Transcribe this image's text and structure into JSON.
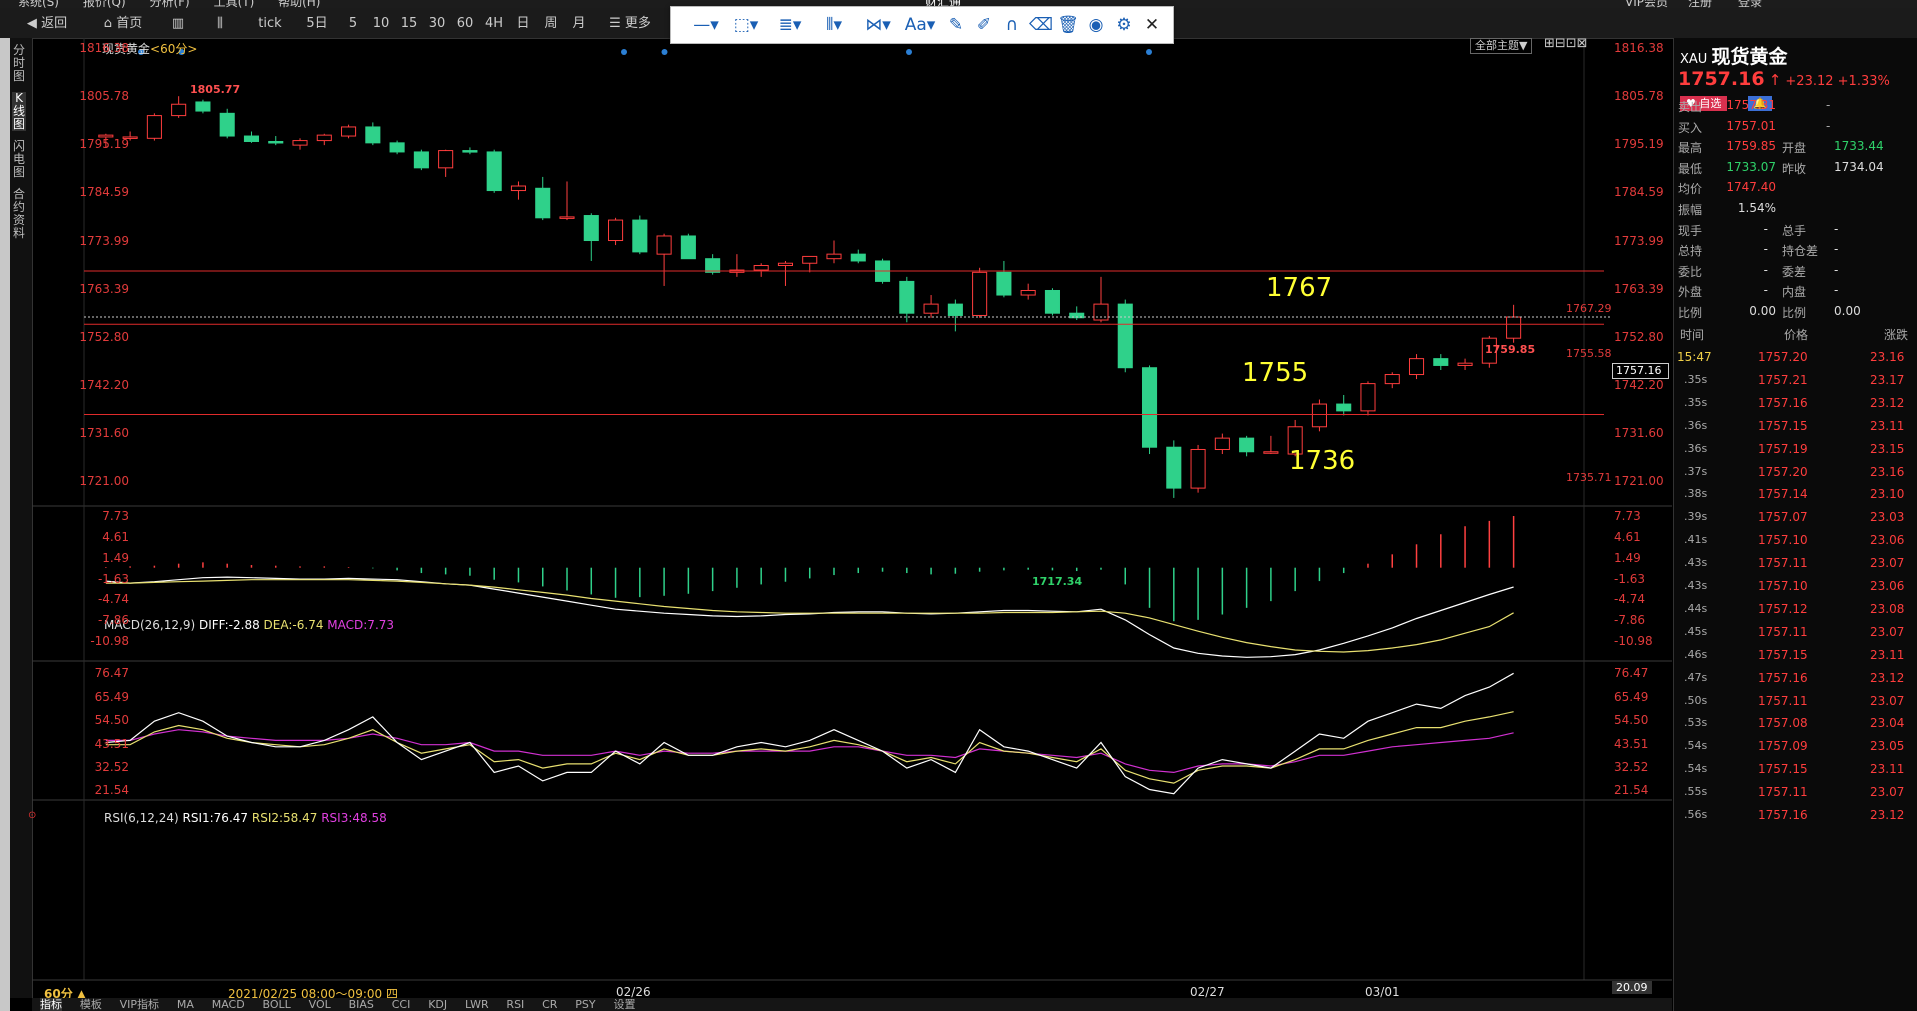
{
  "menubar": [
    "系统(S)",
    "报价(Q)",
    "分析(F)",
    "工具(T)",
    "帮助(H)"
  ],
  "app_title": "财汇通",
  "top_right": [
    "VIP会员",
    "注册",
    "登录"
  ],
  "toolbar": {
    "back": "返回",
    "home": "首页",
    "tick": "tick",
    "periods": [
      "5日",
      "5",
      "10",
      "15",
      "30",
      "60",
      "4H",
      "日",
      "周",
      "月"
    ],
    "more": "更多"
  },
  "draw_tools": {
    "items": [
      "line-tool",
      "shape-tool",
      "fib-tool",
      "channel-tool",
      "pattern-tool",
      "text-tool",
      "brush-tool",
      "marker-tool",
      "magnet-tool",
      "eraser-tool",
      "delete-tool",
      "eye-tool",
      "gear-tool",
      "close-tool"
    ],
    "text_label": "Aa"
  },
  "side_tabs": [
    "分时图",
    "K线图",
    "闪电图",
    "合约资料"
  ],
  "chart_header": {
    "name": "现货黄金",
    "period": "<60分>",
    "theme": "全部主题▼"
  },
  "price_axis": [
    "1816.38",
    "1805.78",
    "1795.19",
    "1784.59",
    "1773.99",
    "1763.39",
    "1752.80",
    "1742.20",
    "1731.60",
    "1721.00"
  ],
  "annotations": {
    "high": "1805.77",
    "low": "1717.34",
    "hi2": "1759.85",
    "l1767": "1767",
    "l1755": "1755",
    "l1736": "1736",
    "r1767": "1767.29",
    "r1755": "1755.58",
    "r1736": "1735.71",
    "last": "1757.16"
  },
  "macd": {
    "header": "MACD(26,12,9)",
    "diff": "DIFF:-2.88",
    "dea": "DEA:-6.74",
    "macd": "MACD:7.73",
    "axis": [
      "7.73",
      "4.61",
      "1.49",
      "-1.63",
      "-4.74",
      "-7.86",
      "-10.98"
    ]
  },
  "rsi": {
    "header": "RSI(6,12,24)",
    "rsi1": "RSI1:76.47",
    "rsi2": "RSI2:58.47",
    "rsi3": "RSI3:48.58",
    "axis": [
      "76.47",
      "65.49",
      "54.50",
      "43.51",
      "32.52",
      "21.54"
    ],
    "last": "20.09"
  },
  "xaxis": {
    "period_btn": "60分 ▲",
    "range": "2021/02/25 08:00～09:00 四",
    "dates": [
      "02/26",
      "02/27",
      "03/01"
    ]
  },
  "bottom_tabs": [
    "指标",
    "模板",
    "VIP指标",
    "MA",
    "MACD",
    "BOLL",
    "VOL",
    "BIAS",
    "CCI",
    "KDJ",
    "LWR",
    "RSI",
    "CR",
    "PSY",
    "设置"
  ],
  "chart_data": {
    "type": "candlestick",
    "title": "现货黄金 60分",
    "ohlc": [
      [
        1796.8,
        1797.5,
        1794.5,
        1797.2
      ],
      [
        1796.8,
        1798.0,
        1796.0,
        1796.8
      ],
      [
        1796.5,
        1802.0,
        1796.0,
        1801.5
      ],
      [
        1801.5,
        1805.77,
        1801.0,
        1804.0
      ],
      [
        1804.5,
        1805.0,
        1802.0,
        1802.5
      ],
      [
        1802.0,
        1803.0,
        1796.5,
        1797.0
      ],
      [
        1797.0,
        1798.0,
        1795.5,
        1795.8
      ],
      [
        1795.8,
        1797.0,
        1795.0,
        1795.6
      ],
      [
        1795.0,
        1796.5,
        1794.0,
        1796.0
      ],
      [
        1796.0,
        1797.5,
        1795.0,
        1797.2
      ],
      [
        1797.0,
        1799.5,
        1796.5,
        1799.0
      ],
      [
        1799.0,
        1800.0,
        1795.0,
        1795.5
      ],
      [
        1795.5,
        1796.0,
        1793.0,
        1793.5
      ],
      [
        1793.5,
        1794.0,
        1789.5,
        1790.0
      ],
      [
        1790.0,
        1794.0,
        1788.0,
        1793.8
      ],
      [
        1793.8,
        1794.5,
        1793.0,
        1793.5
      ],
      [
        1793.5,
        1794.0,
        1784.5,
        1785.0
      ],
      [
        1785.0,
        1787.0,
        1783.0,
        1786.0
      ],
      [
        1785.5,
        1788.0,
        1778.5,
        1779.0
      ],
      [
        1779.0,
        1787.0,
        1778.5,
        1779.2
      ],
      [
        1779.5,
        1780.0,
        1769.5,
        1774.0
      ],
      [
        1774.0,
        1779.0,
        1773.0,
        1778.5
      ],
      [
        1778.5,
        1779.5,
        1771.0,
        1771.5
      ],
      [
        1771.0,
        1775.5,
        1764.0,
        1775.0
      ],
      [
        1775.0,
        1775.5,
        1770.0,
        1770.0
      ],
      [
        1770.0,
        1771.0,
        1766.5,
        1767.0
      ],
      [
        1767.0,
        1771.0,
        1766.0,
        1767.5
      ],
      [
        1767.5,
        1769.0,
        1766.0,
        1768.5
      ],
      [
        1768.5,
        1769.5,
        1764.0,
        1769.0
      ],
      [
        1769.0,
        1770.5,
        1767.0,
        1770.5
      ],
      [
        1770.0,
        1774.0,
        1769.0,
        1771.0
      ],
      [
        1771.0,
        1772.0,
        1769.0,
        1769.5
      ],
      [
        1769.5,
        1770.0,
        1764.5,
        1765.0
      ],
      [
        1765.0,
        1766.0,
        1756.0,
        1758.0
      ],
      [
        1758.0,
        1762.0,
        1757.0,
        1760.0
      ],
      [
        1760.0,
        1761.0,
        1754.0,
        1757.5
      ],
      [
        1757.5,
        1768.0,
        1757.0,
        1767.0
      ],
      [
        1767.0,
        1769.5,
        1761.5,
        1762.0
      ],
      [
        1762.0,
        1764.5,
        1761.0,
        1763.0
      ],
      [
        1763.0,
        1763.5,
        1757.5,
        1758.0
      ],
      [
        1758.0,
        1759.5,
        1756.5,
        1757.0
      ],
      [
        1756.5,
        1766.0,
        1756.0,
        1760.0
      ],
      [
        1760.0,
        1761.0,
        1745.0,
        1746.0
      ],
      [
        1746.0,
        1746.5,
        1727.0,
        1728.5
      ],
      [
        1728.5,
        1730.0,
        1717.34,
        1719.5
      ],
      [
        1719.5,
        1729.0,
        1718.5,
        1728.0
      ],
      [
        1728.0,
        1731.5,
        1727.0,
        1730.5
      ],
      [
        1730.5,
        1731.0,
        1726.5,
        1727.5
      ],
      [
        1727.5,
        1731.0,
        1727.0,
        1727.5
      ],
      [
        1727.0,
        1734.5,
        1726.5,
        1733.0
      ],
      [
        1733.0,
        1739.0,
        1732.0,
        1738.0
      ],
      [
        1738.0,
        1740.0,
        1735.5,
        1736.5
      ],
      [
        1736.5,
        1743.0,
        1735.5,
        1742.5
      ],
      [
        1742.5,
        1745.0,
        1741.5,
        1744.5
      ],
      [
        1744.5,
        1749.0,
        1743.5,
        1748.0
      ],
      [
        1748.0,
        1749.0,
        1745.5,
        1746.5
      ],
      [
        1746.5,
        1748.0,
        1745.5,
        1747.0
      ],
      [
        1747.0,
        1753.0,
        1746.0,
        1752.5
      ],
      [
        1752.5,
        1759.85,
        1751.5,
        1757.16
      ]
    ],
    "hlines": [
      {
        "value": 1767.29,
        "label": "1767"
      },
      {
        "value": 1755.58,
        "label": "1755"
      },
      {
        "value": 1735.71,
        "label": "1736"
      }
    ],
    "ylim": [
      1716.0,
      1816.38
    ],
    "macd_hist": [
      0.1,
      0.2,
      0.3,
      0.6,
      0.8,
      0.6,
      0.4,
      0.3,
      0.2,
      0.2,
      0.1,
      -0.1,
      -0.4,
      -0.8,
      -1.0,
      -1.2,
      -1.8,
      -2.2,
      -2.8,
      -3.4,
      -4.0,
      -4.5,
      -4.4,
      -4.2,
      -3.9,
      -3.5,
      -3.0,
      -2.5,
      -2.1,
      -1.6,
      -1.1,
      -0.8,
      -0.6,
      -0.8,
      -1.0,
      -0.9,
      -0.6,
      -0.4,
      -0.3,
      -0.4,
      -0.5,
      -0.3,
      -2.5,
      -6.0,
      -8.0,
      -7.8,
      -7.0,
      -6.0,
      -5.0,
      -3.5,
      -2.0,
      -0.8,
      0.6,
      2.0,
      3.5,
      5.0,
      6.2,
      7.0,
      7.73
    ],
    "diff": [
      -2.0,
      -2.3,
      -2.1,
      -1.8,
      -1.5,
      -1.4,
      -1.5,
      -1.6,
      -1.7,
      -1.7,
      -1.6,
      -1.7,
      -1.8,
      -2.1,
      -2.4,
      -2.6,
      -3.2,
      -3.8,
      -4.4,
      -5.0,
      -5.6,
      -6.2,
      -6.5,
      -6.8,
      -7.0,
      -7.2,
      -7.3,
      -7.2,
      -7.0,
      -6.9,
      -6.7,
      -6.6,
      -6.6,
      -6.8,
      -6.9,
      -6.8,
      -6.6,
      -6.4,
      -6.4,
      -6.5,
      -6.6,
      -6.2,
      -7.8,
      -10.0,
      -12.0,
      -12.8,
      -13.2,
      -13.4,
      -13.3,
      -13.0,
      -12.3,
      -11.3,
      -10.2,
      -9.0,
      -7.6,
      -6.4,
      -5.2,
      -4.0,
      -2.88
    ],
    "dea": [
      -2.3,
      -2.3,
      -2.2,
      -2.1,
      -2.0,
      -1.9,
      -1.8,
      -1.8,
      -1.8,
      -1.8,
      -1.8,
      -1.9,
      -2.0,
      -2.2,
      -2.4,
      -2.6,
      -2.9,
      -3.3,
      -3.7,
      -4.1,
      -4.6,
      -5.0,
      -5.4,
      -5.8,
      -6.1,
      -6.4,
      -6.6,
      -6.7,
      -6.8,
      -6.8,
      -6.8,
      -6.8,
      -6.8,
      -6.8,
      -6.8,
      -6.8,
      -6.8,
      -6.7,
      -6.7,
      -6.7,
      -6.6,
      -6.5,
      -6.8,
      -7.5,
      -8.5,
      -9.5,
      -10.4,
      -11.2,
      -11.8,
      -12.3,
      -12.5,
      -12.6,
      -12.4,
      -12.0,
      -11.5,
      -10.8,
      -9.8,
      -8.8,
      -6.74
    ],
    "rsi1": [
      44,
      45,
      54,
      58,
      54,
      47,
      44,
      42,
      42,
      45,
      50,
      56,
      44,
      36,
      40,
      44,
      30,
      33,
      26,
      30,
      30,
      40,
      34,
      44,
      38,
      38,
      42,
      44,
      42,
      45,
      50,
      45,
      40,
      32,
      36,
      30,
      50,
      42,
      40,
      36,
      32,
      44,
      28,
      22,
      20,
      32,
      36,
      34,
      32,
      40,
      48,
      46,
      54,
      58,
      62,
      60,
      66,
      70,
      76.47
    ],
    "rsi2": [
      43,
      43,
      49,
      52,
      50,
      46,
      44,
      43,
      42,
      43,
      46,
      50,
      44,
      39,
      41,
      43,
      35,
      36,
      32,
      34,
      34,
      39,
      36,
      41,
      38,
      38,
      40,
      41,
      40,
      42,
      45,
      43,
      40,
      35,
      37,
      34,
      44,
      40,
      39,
      37,
      35,
      41,
      31,
      27,
      25,
      31,
      33,
      33,
      32,
      36,
      41,
      41,
      45,
      48,
      51,
      51,
      54,
      56,
      58.47
    ],
    "rsi3": [
      45,
      45,
      48,
      50,
      49,
      47,
      46,
      45,
      45,
      45,
      46,
      48,
      46,
      43,
      43,
      44,
      40,
      40,
      38,
      38,
      38,
      40,
      38,
      40,
      39,
      39,
      40,
      40,
      40,
      40,
      42,
      42,
      40,
      38,
      38,
      37,
      41,
      40,
      39,
      38,
      37,
      39,
      34,
      31,
      30,
      33,
      34,
      34,
      33,
      35,
      38,
      38,
      40,
      42,
      43,
      44,
      45,
      46,
      48.58
    ]
  },
  "rightpanel": {
    "symbol": "XAU",
    "name": "现货黄金",
    "price": "1757.16",
    "arrow": "↑",
    "change": "+23.12",
    "pct": "+1.33%",
    "watch": "自选",
    "quotes": [
      {
        "k": "卖出",
        "v": "1757.31",
        "k2": "-",
        "v2": ""
      },
      {
        "k": "买入",
        "v": "1757.01",
        "k2": "-",
        "v2": ""
      },
      {
        "k": "最高",
        "v": "1759.85",
        "k2": "开盘",
        "v2": "1733.44"
      },
      {
        "k": "最低",
        "v": "1733.07",
        "k2": "昨收",
        "v2": "1734.04"
      },
      {
        "k": "均价",
        "v": "1747.40",
        "k2": "",
        "v2": ""
      },
      {
        "k": "振幅",
        "v": "1.54%",
        "k2": "",
        "v2": ""
      },
      {
        "k": "现手",
        "v": "-",
        "k2": "总手",
        "v2": "-"
      },
      {
        "k": "总持",
        "v": "-",
        "k2": "持仓差",
        "v2": "-"
      },
      {
        "k": "委比",
        "v": "-",
        "k2": "委差",
        "v2": "-"
      },
      {
        "k": "外盘",
        "v": "-",
        "k2": "内盘",
        "v2": "-"
      },
      {
        "k": "比例",
        "v": "0.00",
        "k2": "比例",
        "v2": "0.00"
      }
    ],
    "tick_headers": [
      "时间",
      "价格",
      "涨跌"
    ],
    "ticks": [
      [
        "15:47",
        "1757.20",
        "23.16"
      ],
      [
        ".35s",
        "1757.21",
        "23.17"
      ],
      [
        ".35s",
        "1757.16",
        "23.12"
      ],
      [
        ".36s",
        "1757.15",
        "23.11"
      ],
      [
        ".36s",
        "1757.19",
        "23.15"
      ],
      [
        ".37s",
        "1757.20",
        "23.16"
      ],
      [
        ".38s",
        "1757.14",
        "23.10"
      ],
      [
        ".39s",
        "1757.07",
        "23.03"
      ],
      [
        ".41s",
        "1757.10",
        "23.06"
      ],
      [
        ".43s",
        "1757.11",
        "23.07"
      ],
      [
        ".43s",
        "1757.10",
        "23.06"
      ],
      [
        ".44s",
        "1757.12",
        "23.08"
      ],
      [
        ".45s",
        "1757.11",
        "23.07"
      ],
      [
        ".46s",
        "1757.15",
        "23.11"
      ],
      [
        ".47s",
        "1757.16",
        "23.12"
      ],
      [
        ".50s",
        "1757.11",
        "23.07"
      ],
      [
        ".53s",
        "1757.08",
        "23.04"
      ],
      [
        ".54s",
        "1757.09",
        "23.05"
      ],
      [
        ".54s",
        "1757.15",
        "23.11"
      ],
      [
        ".55s",
        "1757.11",
        "23.07"
      ],
      [
        ".56s",
        "1757.16",
        "23.12"
      ]
    ]
  },
  "colors": {
    "up": "#ff3d3d",
    "down": "#2fd18a",
    "level": "#e02b2b",
    "annot": "#ffff33"
  }
}
